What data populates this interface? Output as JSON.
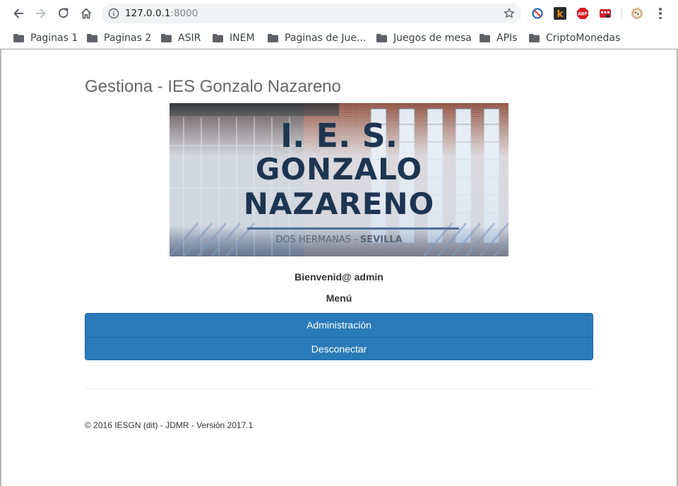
{
  "browser": {
    "url_host": "127.0.0.1",
    "url_port": ":8000",
    "bookmarks": [
      {
        "label": "Paginas 1"
      },
      {
        "label": "Paginas 2"
      },
      {
        "label": "ASIR"
      },
      {
        "label": "INEM"
      },
      {
        "label": "Paginas de Jue..."
      },
      {
        "label": "Juegos de mesa"
      },
      {
        "label": "APIs"
      },
      {
        "label": "CriptoMonedas"
      }
    ],
    "extensions": [
      {
        "icon": "block-icon",
        "color": "#1a5fb4"
      },
      {
        "icon": "k-icon",
        "color": "#f29111",
        "text": "k"
      },
      {
        "icon": "abp-icon",
        "color": "#d71921",
        "text": "ABP"
      },
      {
        "icon": "video-icon",
        "color": "#cc1f2f"
      },
      {
        "icon": "profile-icon",
        "color": "#e8d6b5"
      }
    ]
  },
  "page": {
    "title": "Gestiona - IES Gonzalo Nazareno",
    "banner": {
      "line1": "I. E. S.",
      "line2": "GONZALO",
      "line3": "NAZARENO",
      "subtitle_left": "DOS HERMANAS - ",
      "subtitle_right": "SEVILLA"
    },
    "welcome": "Bienvenid@ admin",
    "menu_title": "Menú",
    "menu_items": [
      {
        "label": "Administración"
      },
      {
        "label": "Desconectar"
      }
    ],
    "footer": "© 2016 IESGN (dit) - JDMR - Versión 2017.1"
  },
  "colors": {
    "menu_bg": "#2a7ab7",
    "title_text": "#666666",
    "banner_text": "#1e3550"
  }
}
